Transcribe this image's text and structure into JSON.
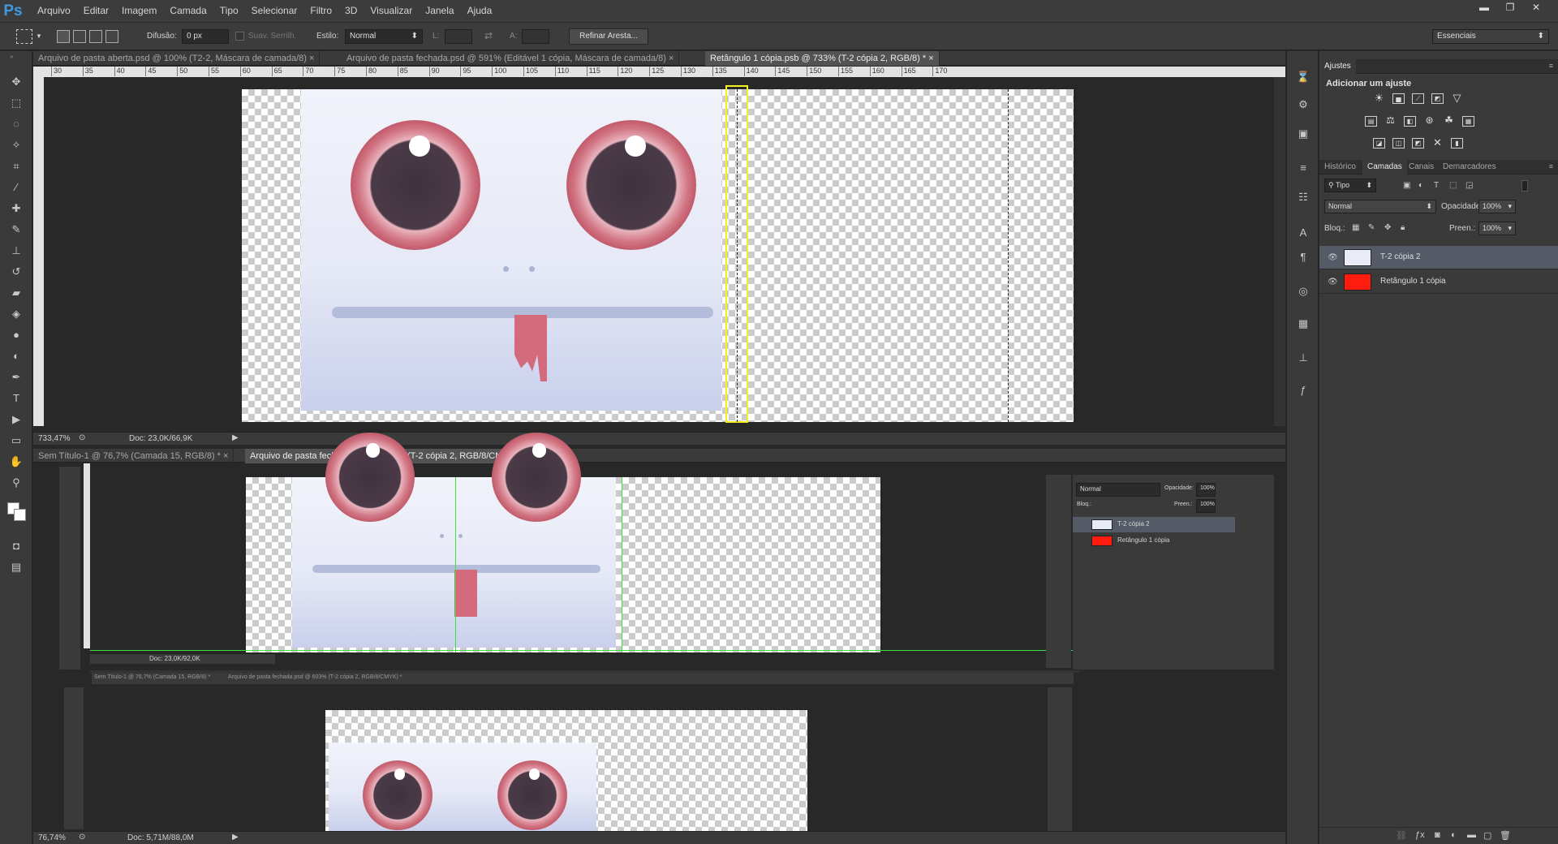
{
  "app": {
    "logo": "Ps"
  },
  "menu": [
    "Arquivo",
    "Editar",
    "Imagem",
    "Camada",
    "Tipo",
    "Selecionar",
    "Filtro",
    "3D",
    "Visualizar",
    "Janela",
    "Ajuda"
  ],
  "window_controls": {
    "minimize": "▬",
    "restore": "❐",
    "close": "✕"
  },
  "options": {
    "feather_label": "Difusão:",
    "feather_value": "0 px",
    "antialias_label": "Suav. Serrilh.",
    "style_label": "Estilo:",
    "style_value": "Normal",
    "width_label": "L:",
    "height_label": "A:",
    "refine_button": "Refinar Aresta...",
    "workspace_value": "Essenciais"
  },
  "doc_tabs": {
    "top": [
      "Arquivo de pasta aberta.psd @ 100% (T2-2, Máscara de camada/8)",
      "Arquivo de pasta fechada.psd @ 591% (Editável 1 cópia, Máscara de camada/8)",
      "Retângulo 1 cópia.psb @ 733% (T-2 cópia 2, RGB/8) *"
    ],
    "middle": [
      "Sem Título-1 @ 76,7% (Camada 15, RGB/8) *",
      "Arquivo de pasta fechada.psd @ 603% (T-2 cópia 2, RGB/8/CMYK) *"
    ],
    "bottom": [
      "Sem Título-1 @ 76,7% (Camada 15, RGB/8) *",
      "Arquivo de pasta fechada.psd @ 603% (T-2 cópia 2, RGB/8/CMYK) *"
    ]
  },
  "ruler_ticks": [
    "30",
    "35",
    "40",
    "45",
    "50",
    "55",
    "60",
    "65",
    "70",
    "75",
    "80",
    "85",
    "90",
    "95",
    "100",
    "105",
    "110",
    "115",
    "120",
    "125",
    "130",
    "135",
    "140",
    "145",
    "150",
    "155",
    "160",
    "165",
    "170"
  ],
  "status": {
    "top_zoom": "733,47%",
    "top_doc": "Doc: 23,0K/66,9K",
    "mid_zoom": "",
    "mid_doc": "Doc: 23,0K/92,0K",
    "bottom_zoom": "76,74%",
    "bottom_doc": "Doc: 5,71M/88,0M"
  },
  "adjustments": {
    "tab": "Ajustes",
    "title": "Adicionar um ajuste"
  },
  "layers_panel": {
    "tabs": [
      "Histórico",
      "Camadas",
      "Canais",
      "Demarcadores"
    ],
    "active_tab": "Camadas",
    "filter_value": "Tipo",
    "blend_mode": "Normal",
    "opacity_label": "Opacidade:",
    "opacity_value": "100%",
    "lock_label": "Bloq.:",
    "fill_label": "Preen.:",
    "fill_value": "100%",
    "layers": [
      {
        "name": "T-2 cópia 2",
        "selected": true
      },
      {
        "name": "Retângulo 1 cópia",
        "selected": false
      }
    ]
  },
  "mini_layers": {
    "blend_mode": "Normal",
    "opacity_label": "Opacidade:",
    "opacity_value": "100%",
    "lock_label": "Bloq.:",
    "fill_label": "Preen.:",
    "fill_value": "100%",
    "layers": [
      "T-2 cópia 2",
      "Retângulo 1 cópia"
    ]
  },
  "colors": {
    "accent": "#3f9ae0",
    "layer_red": "#ff1b0d",
    "selection_yellow": "#f5f21b",
    "guide_green": "#3fe13f"
  }
}
